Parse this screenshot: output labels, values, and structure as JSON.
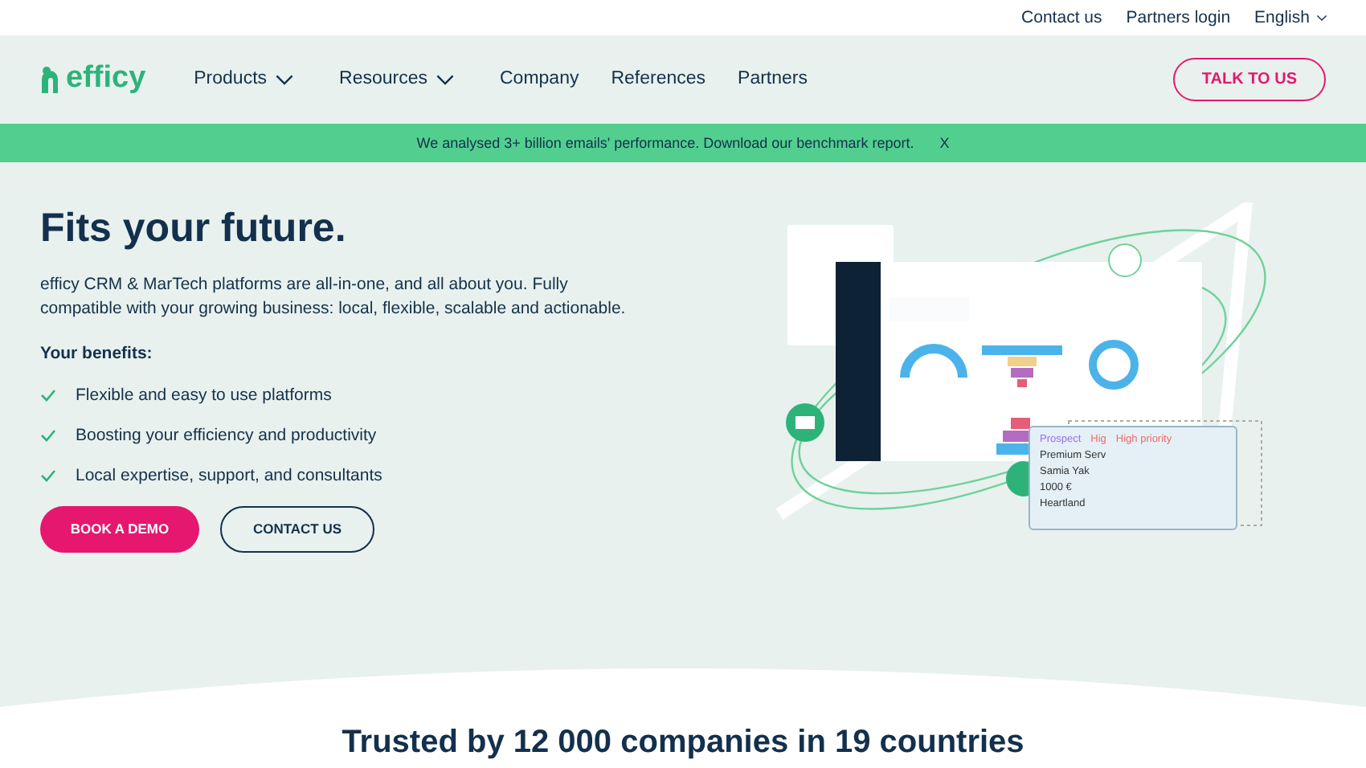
{
  "topbar": {
    "links": [
      "Contact us",
      "Partners login"
    ],
    "language": "English"
  },
  "nav": {
    "logo": "efficy",
    "items": [
      {
        "label": "Products",
        "dropdown": true
      },
      {
        "label": "Resources",
        "dropdown": true
      },
      {
        "label": "Company",
        "dropdown": false
      },
      {
        "label": "References",
        "dropdown": false
      },
      {
        "label": "Partners",
        "dropdown": false
      }
    ],
    "cta": "TALK TO US"
  },
  "banner": {
    "text": "We analysed 3+ billion emails' performance. Download our benchmark report.",
    "close": "X"
  },
  "hero": {
    "title": "Fits your future.",
    "description": "efficy CRM & MarTech platforms are all-in-one, and all about you. Fully compatible with your growing business: local, flexible, scalable and actionable.",
    "benefits_title": "Your benefits:",
    "benefits": [
      "Flexible and easy to use platforms",
      "Boosting your efficiency and productivity",
      "Local expertise, support, and consultants"
    ],
    "buttons": [
      "BOOK A DEMO",
      "CONTACT US"
    ]
  },
  "illustration": {
    "card": {
      "tags": [
        "Prospect",
        "Hig",
        "High priority"
      ],
      "title": "Premium Serv",
      "contact": "Samia Yak",
      "amount": "1000 €",
      "company": "Heartland"
    }
  },
  "trusted": {
    "title": "Trusted by 12 000 companies in 19 countries"
  }
}
